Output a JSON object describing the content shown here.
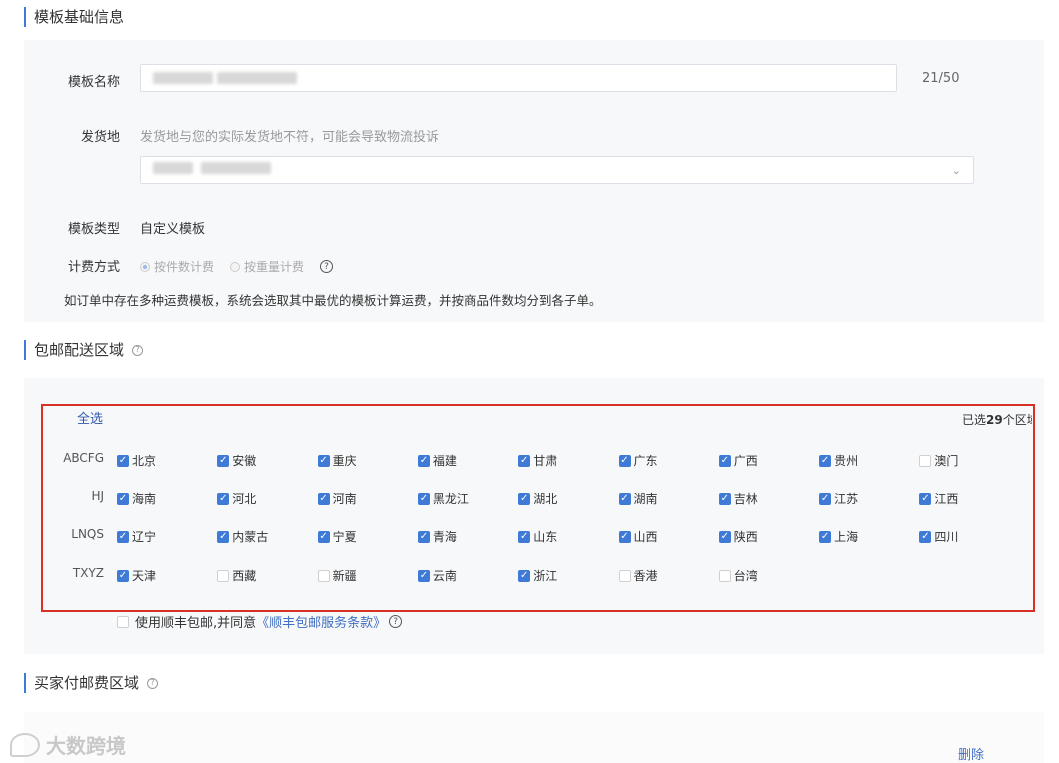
{
  "basic_info": {
    "title": "模板基础信息",
    "template_name_label": "模板名称",
    "template_name_counter": "21/50",
    "ship_from_label": "发货地",
    "ship_from_hint": "发货地与您的实际发货地不符，可能会导致物流投诉",
    "template_type_label": "模板类型",
    "template_type_value": "自定义模板",
    "billing_label": "计费方式",
    "billing_options": [
      {
        "label": "按件数计费",
        "selected": true
      },
      {
        "label": "按重量计费",
        "selected": false
      }
    ],
    "help_glyph": "?",
    "note": "如订单中存在多种运费模板，系统会选取其中最优的模板计算运费，并按商品件数均分到各子单。"
  },
  "free_shipping": {
    "title": "包邮配送区域",
    "select_all": "全选",
    "selected_prefix": "已选",
    "selected_count": "29",
    "selected_suffix": "个区域",
    "rows": [
      {
        "label": "ABCFG",
        "items": [
          {
            "name": "北京",
            "checked": true
          },
          {
            "name": "安徽",
            "checked": true
          },
          {
            "name": "重庆",
            "checked": true
          },
          {
            "name": "福建",
            "checked": true
          },
          {
            "name": "甘肃",
            "checked": true
          },
          {
            "name": "广东",
            "checked": true
          },
          {
            "name": "广西",
            "checked": true
          },
          {
            "name": "贵州",
            "checked": true
          },
          {
            "name": "澳门",
            "checked": false
          }
        ]
      },
      {
        "label": "HJ",
        "items": [
          {
            "name": "海南",
            "checked": true
          },
          {
            "name": "河北",
            "checked": true
          },
          {
            "name": "河南",
            "checked": true
          },
          {
            "name": "黑龙江",
            "checked": true
          },
          {
            "name": "湖北",
            "checked": true
          },
          {
            "name": "湖南",
            "checked": true
          },
          {
            "name": "吉林",
            "checked": true
          },
          {
            "name": "江苏",
            "checked": true
          },
          {
            "name": "江西",
            "checked": true
          }
        ]
      },
      {
        "label": "LNQS",
        "items": [
          {
            "name": "辽宁",
            "checked": true
          },
          {
            "name": "内蒙古",
            "checked": true
          },
          {
            "name": "宁夏",
            "checked": true
          },
          {
            "name": "青海",
            "checked": true
          },
          {
            "name": "山东",
            "checked": true
          },
          {
            "name": "山西",
            "checked": true
          },
          {
            "name": "陕西",
            "checked": true
          },
          {
            "name": "上海",
            "checked": true
          },
          {
            "name": "四川",
            "checked": true
          }
        ]
      },
      {
        "label": "TXYZ",
        "items": [
          {
            "name": "天津",
            "checked": true
          },
          {
            "name": "西藏",
            "checked": false
          },
          {
            "name": "新疆",
            "checked": false
          },
          {
            "name": "云南",
            "checked": true
          },
          {
            "name": "浙江",
            "checked": true
          },
          {
            "name": "香港",
            "checked": false
          },
          {
            "name": "台湾",
            "checked": false
          }
        ]
      }
    ],
    "sf_agree_text": "使用顺丰包邮,并同意",
    "sf_agree_link": "《顺丰包邮服务条款》"
  },
  "buyer_paid": {
    "title": "买家付邮费区域",
    "delete_label": "删除"
  },
  "watermark": "大数跨境",
  "colors": {
    "accent": "#3f7bd6",
    "highlight_border": "#d93025",
    "link": "#3f6fc2"
  }
}
